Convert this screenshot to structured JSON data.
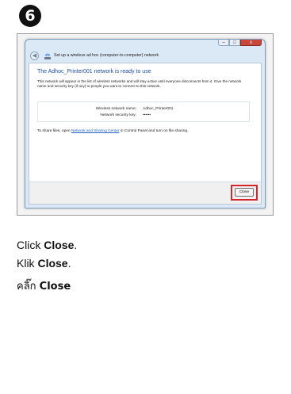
{
  "step": {
    "number": "6"
  },
  "window": {
    "title": "Set up a wireless ad hoc (computer-to-computer) network",
    "heading": "The Adhoc_Printer001 network is ready to use",
    "description": "This network will appear in the list of wireless networks and will stay active until everyone disconnects from it. Give the network name and security key (if any) to people you want to connect to this network.",
    "fields": [
      {
        "label": "Wireless network name:",
        "value": "Adhoc_Printer001"
      },
      {
        "label": "Network security key:",
        "value": "••••••"
      }
    ],
    "share_prefix": "To share files, open ",
    "share_link": "Network and Sharing Center",
    "share_suffix": " in Control Panel and turn on file sharing.",
    "close_button": "Close",
    "titlebar_min": "–",
    "titlebar_max": "□",
    "titlebar_close": "x"
  },
  "instructions": {
    "en_prefix": "Click ",
    "en_bold": "Close",
    "en_suffix": ".",
    "id_prefix": "Klik ",
    "id_bold": "Close",
    "id_suffix": ".",
    "th_prefix": "คลิ๊ก ",
    "th_bold": "Close"
  },
  "colors": {
    "highlight": "#d6262b",
    "heading": "#1f4e9a",
    "link": "#1f5fbf"
  }
}
